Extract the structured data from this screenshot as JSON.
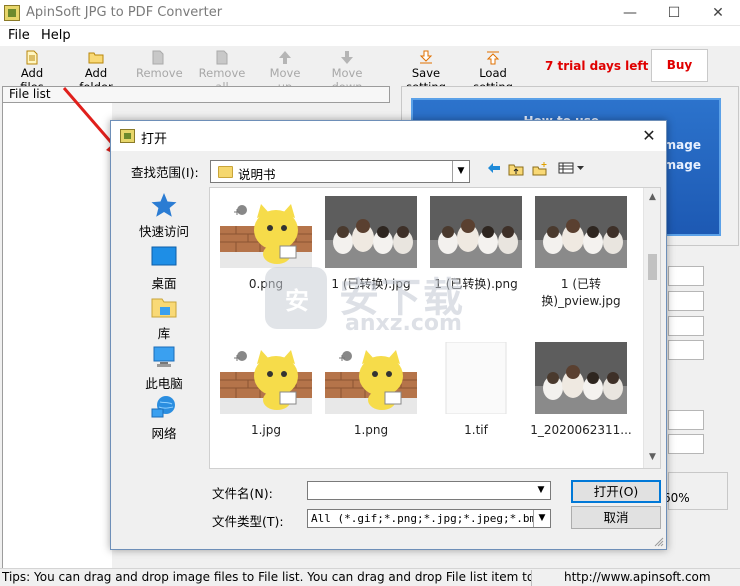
{
  "window": {
    "title": "ApinSoft JPG to PDF Converter",
    "minimize_glyph": "—",
    "maximize_glyph": "☐",
    "close_glyph": "✕"
  },
  "menu": [
    "File",
    "Help"
  ],
  "toolbar": {
    "add_files": "Add files",
    "add_folder": "Add folder",
    "remove": "Remove",
    "remove_all": "Remove all",
    "move_up": "Move up",
    "move_down": "Move down",
    "save_setting": "Save setting",
    "load_setting": "Load setting",
    "trial_text": "7 trial days left",
    "buy_now": "Buy now"
  },
  "file_list_header": "File list",
  "banner": {
    "line1": "How to use",
    "line2": "mage",
    "line3": "e image"
  },
  "zoom_text": "60%",
  "status": {
    "tips": "Tips: You can drag and drop image files to File list. You can drag and drop File list item to",
    "url": "http://www.apinsoft.com"
  },
  "dialog": {
    "title": "打开",
    "close_glyph": "✕",
    "look_in_label": "查找范围(I):",
    "look_in_value": "说明书",
    "places": [
      {
        "label": "快速访问",
        "icon": "star-icon"
      },
      {
        "label": "桌面",
        "icon": "desktop-icon"
      },
      {
        "label": "库",
        "icon": "library-icon"
      },
      {
        "label": "此电脑",
        "icon": "computer-icon"
      },
      {
        "label": "网络",
        "icon": "network-icon"
      }
    ],
    "files": [
      {
        "name": "0.png",
        "kind": "cat"
      },
      {
        "name": "1 (已转换).jpg",
        "kind": "dogs"
      },
      {
        "name": "1 (已转换).png",
        "kind": "dogs"
      },
      {
        "name": "1 (已转换)_pview.jpg",
        "kind": "dogs"
      },
      {
        "name": "1.jpg",
        "kind": "cat"
      },
      {
        "name": "1.png",
        "kind": "cat"
      },
      {
        "name": "1.tif",
        "kind": "blank"
      },
      {
        "name": "1_2020062311...",
        "kind": "dogs"
      }
    ],
    "file_name_label": "文件名(N):",
    "file_name_value": "",
    "file_type_label": "文件类型(T):",
    "file_type_value": "All (*.gif;*.png;*.jpg;*.jpeg;*.bmp;*",
    "open_button": "打开(O)",
    "cancel_button": "取消"
  },
  "watermark": {
    "text": "安下载",
    "sub": "anxz.com"
  },
  "colors": {
    "trial_red": "#e00000",
    "banner_blue": "#1d59b3",
    "arrow_red": "#e0201c"
  }
}
